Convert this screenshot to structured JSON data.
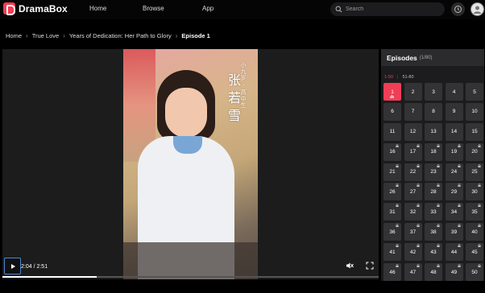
{
  "header": {
    "brand": "DramaBox",
    "nav": [
      "Home",
      "Browse",
      "App"
    ],
    "search_placeholder": "Search",
    "accent": "#ef3e56"
  },
  "breadcrumb": [
    "Home",
    "True Love",
    "Years of Dedication: Her Path to Glory",
    "Episode 1"
  ],
  "player": {
    "time": "2:04 / 2:51",
    "progress": 0.25,
    "overlay_text": {
      "name": "张若雪",
      "role": "小九岁 · 高中生"
    }
  },
  "episodes": {
    "title": "Episodes",
    "count": "(1/80)",
    "ranges": [
      "1-50",
      "51-80"
    ],
    "active_range": 0,
    "current": 1,
    "free_through": 15,
    "items": [
      "1",
      "2",
      "3",
      "4",
      "5",
      "6",
      "7",
      "8",
      "9",
      "10",
      "11",
      "12",
      "13",
      "14",
      "15",
      "16",
      "17",
      "18",
      "19",
      "20",
      "21",
      "22",
      "23",
      "24",
      "25",
      "26",
      "27",
      "28",
      "29",
      "30",
      "31",
      "32",
      "33",
      "34",
      "35",
      "36",
      "37",
      "38",
      "39",
      "40",
      "41",
      "42",
      "43",
      "44",
      "45",
      "46",
      "47",
      "48",
      "49",
      "50"
    ]
  }
}
